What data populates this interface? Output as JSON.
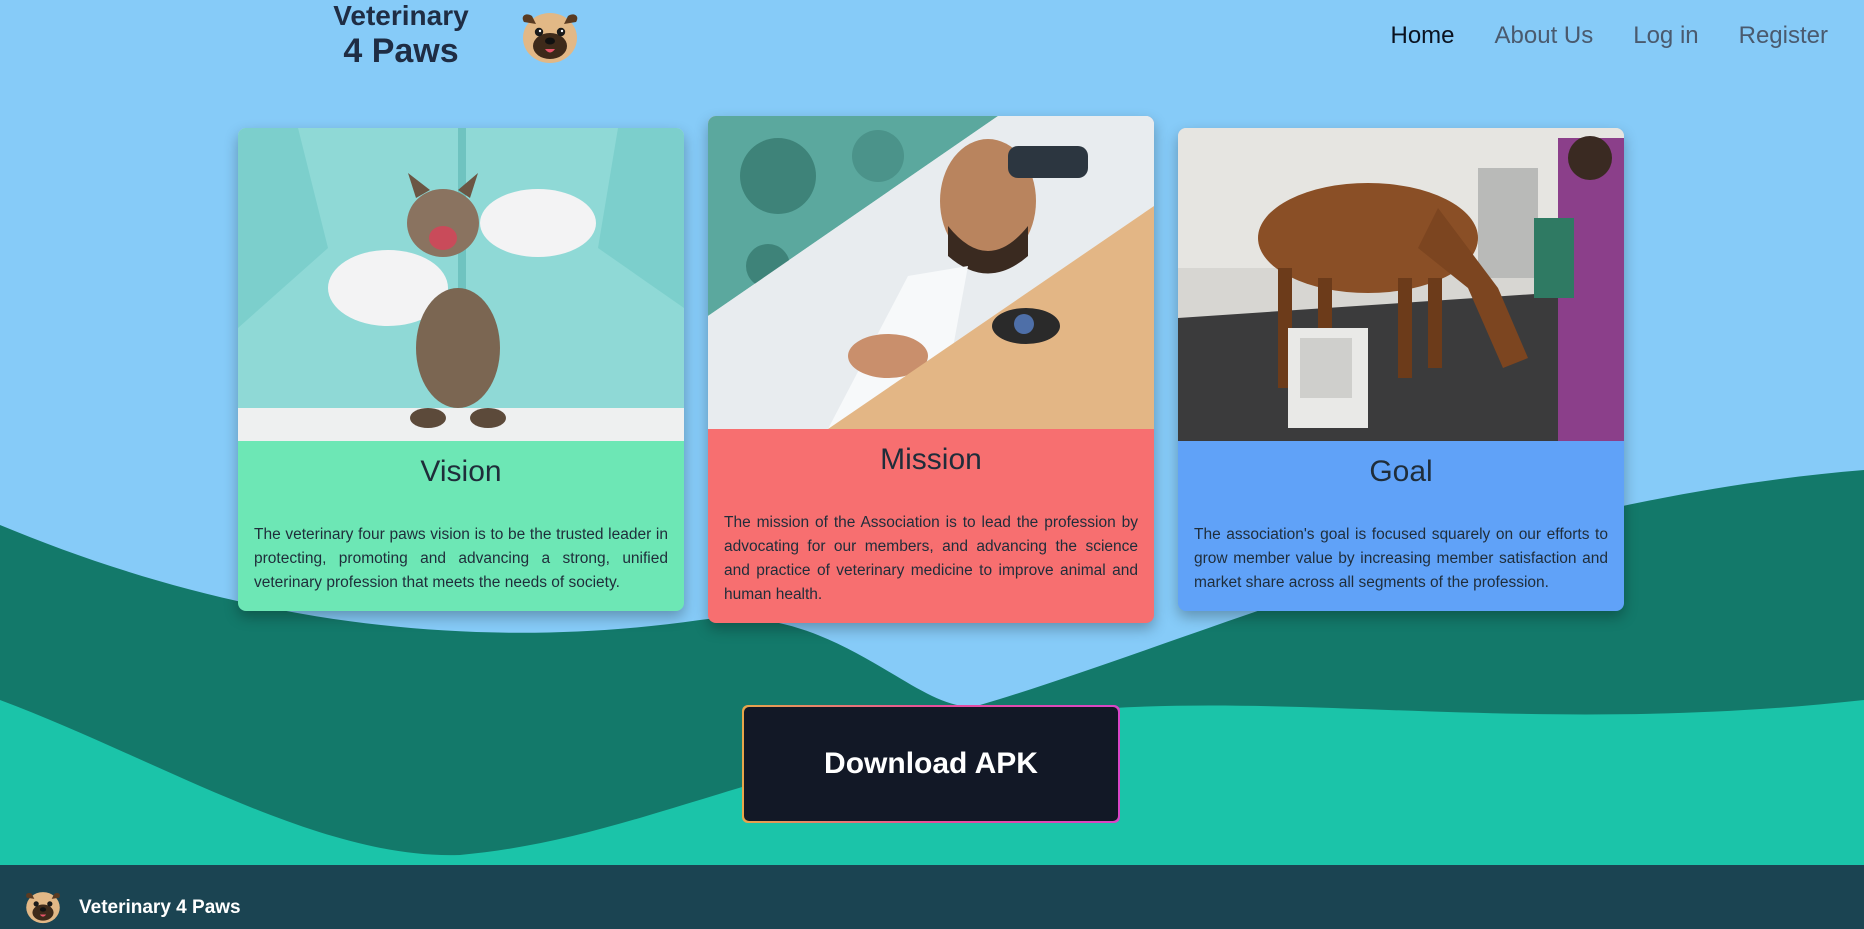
{
  "brand": {
    "line1": "Veterinary",
    "line2": "4 Paws",
    "logo_icon": "pug-dog-icon"
  },
  "nav": {
    "items": [
      {
        "label": "Home",
        "active": true
      },
      {
        "label": "About Us",
        "active": false
      },
      {
        "label": "Log in",
        "active": false
      },
      {
        "label": "Register",
        "active": false
      }
    ]
  },
  "cards": {
    "vision": {
      "title": "Vision",
      "text": "The veterinary four paws vision is to be the trusted leader in protecting, promoting and advancing a strong, unified veterinary profession that meets the needs of society.",
      "color": "#6DE7B5"
    },
    "mission": {
      "title": "Mission",
      "text": "The mission of the Association is to lead the profession by advocating for our members, and advancing the science and practice of veterinary medicine to improve animal and human health.",
      "color": "#F76F70"
    },
    "goal": {
      "title": "Goal",
      "text": "The association's goal is focused squarely on our efforts to grow member value by increasing member satisfaction and market share across all segments of the profession.",
      "color": "#60A2F8"
    }
  },
  "download": {
    "label": "Download APK"
  },
  "footer": {
    "name": "Veterinary 4 Paws",
    "logo_icon": "pug-dog-icon"
  },
  "colors": {
    "sky": "#86CBF8",
    "wave_dark": "#13796A",
    "wave_light": "#1BC4A9",
    "footer": "#1B4452",
    "button": "#121826"
  }
}
